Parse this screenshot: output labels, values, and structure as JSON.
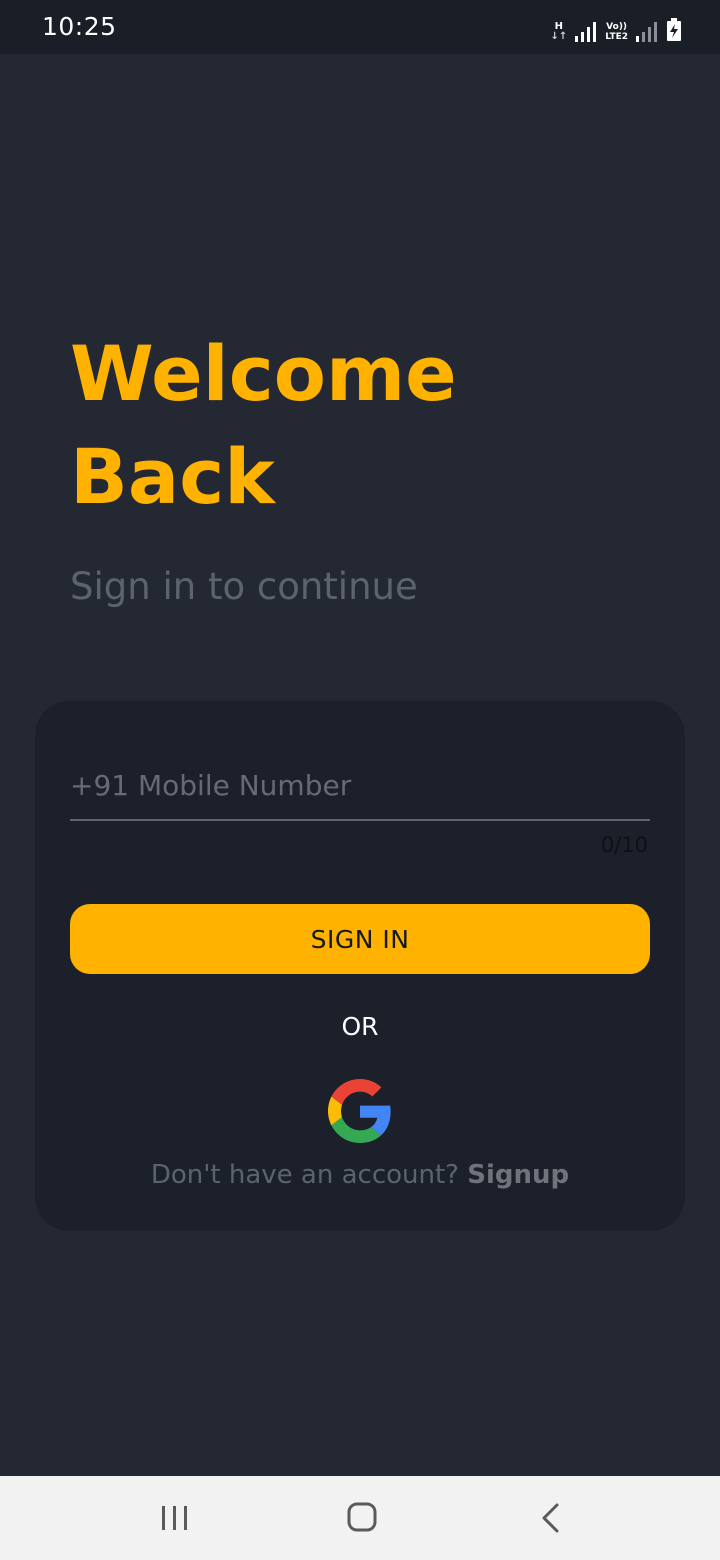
{
  "status_bar": {
    "time": "10:25",
    "network_type": "H",
    "volte_line1": "Vo))",
    "volte_line2": "LTE2"
  },
  "hero": {
    "title_line1": "Welcome",
    "title_line2": "Back",
    "subtitle": "Sign in to continue"
  },
  "form": {
    "mobile_placeholder": "+91 Mobile Number",
    "mobile_value": "",
    "char_counter": "0/10",
    "signin_label": "SIGN IN",
    "or_label": "OR",
    "google_icon": "google-icon",
    "signup_prompt": "Don't have an account?",
    "signup_link": "Signup"
  },
  "nav_bar": {
    "recents_icon": "recents-icon",
    "home_icon": "home-icon",
    "back_icon": "back-icon"
  },
  "colors": {
    "background": "#232833",
    "card": "#1c202a",
    "accent": "#ffb300",
    "muted_text": "#5d636d"
  }
}
